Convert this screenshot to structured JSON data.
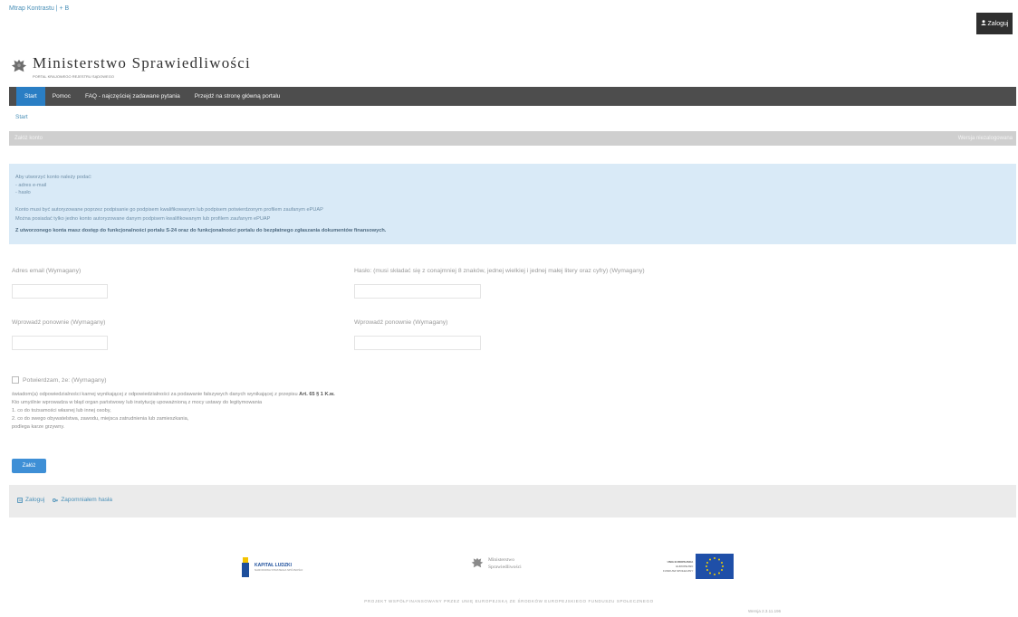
{
  "top": {
    "links": "Mtrap Kontrastu | + B",
    "login_label": "Zaloguj"
  },
  "logo": {
    "title": "Ministerstwo Sprawiedliwości",
    "subtitle": "PORTAL KRAJOWEGO REJESTRU SĄDOWEGO"
  },
  "nav": {
    "items": [
      {
        "label": "Start",
        "active": true
      },
      {
        "label": "Pomoc"
      },
      {
        "label": "FAQ - najczęściej zadawane pytania"
      },
      {
        "label": "Przejdź na stronę główną portalu"
      }
    ]
  },
  "breadcrumb": "Start",
  "section": {
    "left": "Załóż konto",
    "right": "Wersja niezalogowana"
  },
  "info": {
    "lines": [
      "Aby utworzyć konto należy podać:",
      "- adres e-mail",
      "- hasło",
      "Konto musi być autoryzowane poprzez podpisanie go podpisem kwalifikowanym lub podpisem potwierdzonym profilem zaufanym ePUAP",
      "Można posiadać tylko jedno konto autoryzowane danym podpisem kwalifikowanym lub profilem zaufanym ePUAP"
    ],
    "bold_line": "Z utworzonego konta masz dostęp do funkcjonalności portalu S-24 oraz do funkcjonalności portalu do bezpłatnego zgłaszania dokumentów finansowych."
  },
  "form": {
    "email_label": "Adres email (Wymagany)",
    "password_label": "Hasło: (musi składać się z conajmniej 8 znaków, jednej wielkiej i jednej małej litery oraz cyfry) (Wymagany)",
    "repeat_email_label": "Wprowadź ponownie (Wymagany)",
    "repeat_password_label": "Wprowadź ponownie (Wymagany)",
    "confirm_label": "Potwierdzam, że: (Wymagany)"
  },
  "legal": {
    "line1_prefix": "świadom(a) odpowiedzialności karnej wynikającej z odpowiedzialności za podawanie fałszywych danych wynikającej z przepisu",
    "line1_article": "Art. 65 § 1 K.w.",
    "lines": [
      "Kto umyślnie wprowadza w błąd organ państwowy lub instytucję upoważnioną z mocy ustawy do legitymowania",
      "1. co do tożsamości własnej lub innej osoby,",
      "2. co do swego obywatelstwa, zawodu, miejsca zatrudnienia lub zamieszkania,",
      "podlega karze grzywny."
    ]
  },
  "submit_label": "Załóż",
  "bottom_links": {
    "login": "Zaloguj",
    "forgot": "Zapomniałem hasła"
  },
  "footer": {
    "logo1": "KAPITAŁ LUDZKI",
    "logo1_sub": "NARODOWA STRATEGIA SPÓJNOŚCI",
    "logo2_line1": "Ministerstwo",
    "logo2_line2": "Sprawiedliwości",
    "logo3_line1": "UNIA EUROPEJSKA",
    "logo3_line2": "EUROPEJSKI",
    "logo3_line3": "FUNDUSZ SPOŁECZNY",
    "text": "PROJEKT WSPÓŁFINANSOWANY PRZEZ UNIĘ EUROPEJSKĄ ZE ŚRODKÓW EUROPEJSKIEGO FUNDUSZU SPOŁECZNEGO",
    "version": "Wersja 2.3.11.196"
  },
  "colors": {
    "nav_bg": "#4d4d4d",
    "accent": "#2a7ec4",
    "info_bg": "#d9eaf7"
  }
}
